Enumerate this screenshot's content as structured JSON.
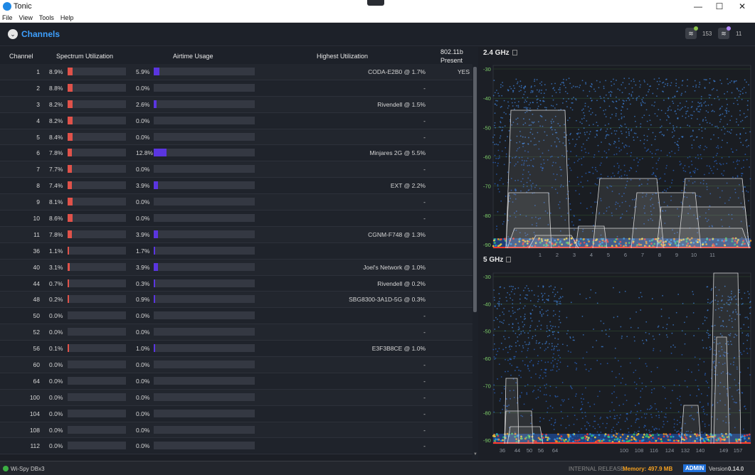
{
  "window": {
    "title": "Tonic",
    "minimize": "—",
    "maximize": "☐",
    "close": "✕"
  },
  "menu": [
    "File",
    "View",
    "Tools",
    "Help"
  ],
  "header": {
    "title": "Channels",
    "icon1_count": "153",
    "icon2_count": "11",
    "dot1_color": "#8bc34a",
    "dot2_color": "#b388ff"
  },
  "columns": {
    "channel": "Channel",
    "spectrum": "Spectrum Utilization",
    "airtime": "Airtime Usage",
    "highest": "Highest Utilization",
    "present_1": "802.11b",
    "present_2": "Present"
  },
  "rows": [
    {
      "ch": "1",
      "sp": "8.9%",
      "sp_frac": 0.089,
      "air": "5.9%",
      "air_frac": 0.059,
      "hi": "CODA-E2B0 @ 1.7%",
      "b": "YES"
    },
    {
      "ch": "2",
      "sp": "8.8%",
      "sp_frac": 0.088,
      "air": "0.0%",
      "air_frac": 0,
      "hi": "-",
      "b": ""
    },
    {
      "ch": "3",
      "sp": "8.2%",
      "sp_frac": 0.082,
      "air": "2.6%",
      "air_frac": 0.026,
      "hi": "Rivendell @ 1.5%",
      "b": ""
    },
    {
      "ch": "4",
      "sp": "8.2%",
      "sp_frac": 0.082,
      "air": "0.0%",
      "air_frac": 0,
      "hi": "-",
      "b": ""
    },
    {
      "ch": "5",
      "sp": "8.4%",
      "sp_frac": 0.084,
      "air": "0.0%",
      "air_frac": 0,
      "hi": "-",
      "b": ""
    },
    {
      "ch": "6",
      "sp": "7.8%",
      "sp_frac": 0.078,
      "air": "12.8%",
      "air_frac": 0.128,
      "hi": "Minjares 2G @ 5.5%",
      "b": ""
    },
    {
      "ch": "7",
      "sp": "7.7%",
      "sp_frac": 0.077,
      "air": "0.0%",
      "air_frac": 0,
      "hi": "-",
      "b": ""
    },
    {
      "ch": "8",
      "sp": "7.4%",
      "sp_frac": 0.074,
      "air": "3.9%",
      "air_frac": 0.039,
      "hi": "EXT @ 2.2%",
      "b": ""
    },
    {
      "ch": "9",
      "sp": "8.1%",
      "sp_frac": 0.081,
      "air": "0.0%",
      "air_frac": 0,
      "hi": "-",
      "b": ""
    },
    {
      "ch": "10",
      "sp": "8.6%",
      "sp_frac": 0.086,
      "air": "0.0%",
      "air_frac": 0,
      "hi": "-",
      "b": ""
    },
    {
      "ch": "11",
      "sp": "7.8%",
      "sp_frac": 0.078,
      "air": "3.9%",
      "air_frac": 0.039,
      "hi": "CGNM-F748 @ 1.3%",
      "b": ""
    },
    {
      "ch": "36",
      "sp": "1.1%",
      "sp_frac": 0.011,
      "air": "1.7%",
      "air_frac": 0.017,
      "hi": "",
      "b": ""
    },
    {
      "ch": "40",
      "sp": "3.1%",
      "sp_frac": 0.031,
      "air": "3.9%",
      "air_frac": 0.039,
      "hi": "Joel's Network @ 1.0%",
      "b": ""
    },
    {
      "ch": "44",
      "sp": "0.7%",
      "sp_frac": 0.007,
      "air": "0.3%",
      "air_frac": 0.003,
      "hi": "Rivendell @ 0.2%",
      "b": ""
    },
    {
      "ch": "48",
      "sp": "0.2%",
      "sp_frac": 0.002,
      "air": "0.9%",
      "air_frac": 0.009,
      "hi": "SBG8300-3A1D-5G @ 0.3%",
      "b": ""
    },
    {
      "ch": "50",
      "sp": "0.0%",
      "sp_frac": 0,
      "air": "0.0%",
      "air_frac": 0,
      "hi": "-",
      "b": ""
    },
    {
      "ch": "52",
      "sp": "0.0%",
      "sp_frac": 0,
      "air": "0.0%",
      "air_frac": 0,
      "hi": "-",
      "b": ""
    },
    {
      "ch": "56",
      "sp": "0.1%",
      "sp_frac": 0.001,
      "air": "1.0%",
      "air_frac": 0.01,
      "hi": "E3F3B8CE @ 1.0%",
      "b": ""
    },
    {
      "ch": "60",
      "sp": "0.0%",
      "sp_frac": 0,
      "air": "0.0%",
      "air_frac": 0,
      "hi": "-",
      "b": ""
    },
    {
      "ch": "64",
      "sp": "0.0%",
      "sp_frac": 0,
      "air": "0.0%",
      "air_frac": 0,
      "hi": "-",
      "b": ""
    },
    {
      "ch": "100",
      "sp": "0.0%",
      "sp_frac": 0,
      "air": "0.0%",
      "air_frac": 0,
      "hi": "-",
      "b": ""
    },
    {
      "ch": "104",
      "sp": "0.0%",
      "sp_frac": 0,
      "air": "0.0%",
      "air_frac": 0,
      "hi": "-",
      "b": ""
    },
    {
      "ch": "108",
      "sp": "0.0%",
      "sp_frac": 0,
      "air": "0.0%",
      "air_frac": 0,
      "hi": "-",
      "b": ""
    },
    {
      "ch": "112",
      "sp": "0.0%",
      "sp_frac": 0,
      "air": "0.0%",
      "air_frac": 0,
      "hi": "-",
      "b": ""
    }
  ],
  "graphs": {
    "g24": {
      "title": "2.4 GHz",
      "yticks": [
        "-30",
        "-40",
        "-50",
        "-60",
        "-70",
        "-80",
        "-90"
      ],
      "xticks": [
        "1",
        "2",
        "3",
        "4",
        "5",
        "6",
        "7",
        "8",
        "9",
        "10",
        "11"
      ]
    },
    "g5": {
      "title": "5 GHz",
      "yticks": [
        "-30",
        "-40",
        "-50",
        "-60",
        "-70",
        "-80",
        "-90"
      ],
      "xticks": [
        "36",
        "44",
        "50",
        "56",
        "64",
        "100",
        "108",
        "116",
        "124",
        "132",
        "140",
        "149",
        "157"
      ]
    }
  },
  "status": {
    "device": "Wi-Spy DBx3",
    "release": "INTERNAL RELEASE",
    "memory": "Memory: 497.9 MB",
    "admin": "ADMIN",
    "version_label": "Version",
    "version": "0.14.0"
  }
}
